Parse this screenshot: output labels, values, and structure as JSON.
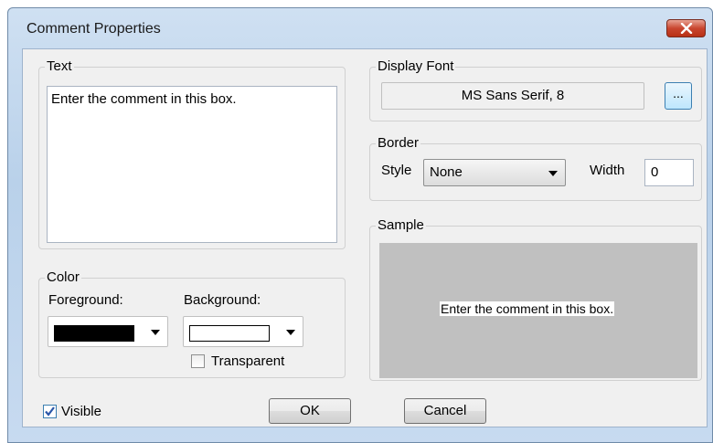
{
  "title": "Comment Properties",
  "close_icon": "close-icon",
  "text_group": {
    "label": "Text",
    "value": "Enter the comment in this box."
  },
  "display_font": {
    "label": "Display Font",
    "value": "MS Sans Serif, 8",
    "browse_label": "..."
  },
  "border": {
    "label": "Border",
    "style_label": "Style",
    "style_value": "None",
    "width_label": "Width",
    "width_value": "0"
  },
  "sample": {
    "label": "Sample",
    "text": "Enter the comment in this box."
  },
  "color": {
    "label": "Color",
    "foreground_label": "Foreground:",
    "foreground_value": "#000000",
    "background_label": "Background:",
    "background_value": "#ffffff",
    "transparent_label": "Transparent",
    "transparent_checked": false
  },
  "visible": {
    "label": "Visible",
    "checked": true
  },
  "buttons": {
    "ok": "OK",
    "cancel": "Cancel"
  }
}
